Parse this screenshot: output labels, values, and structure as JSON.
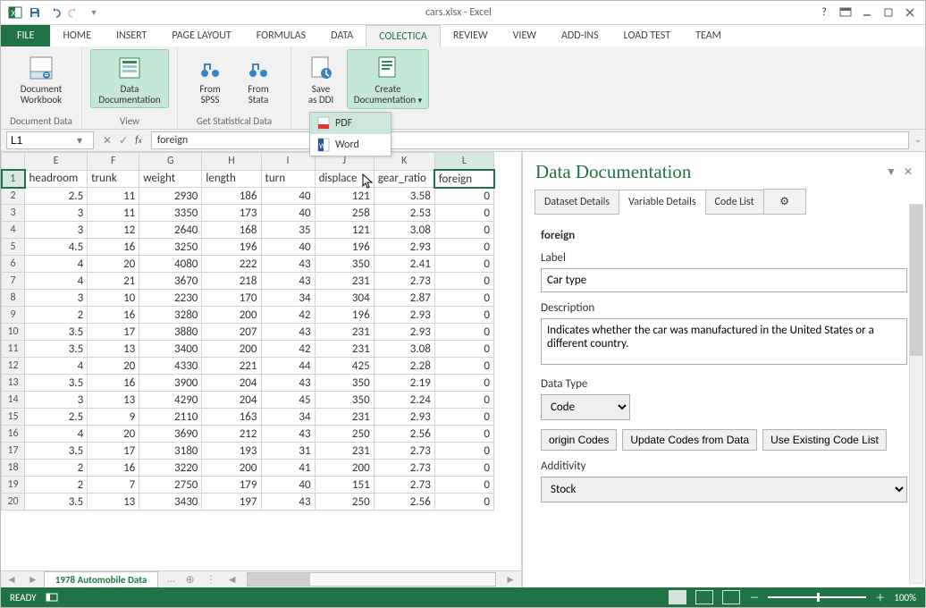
{
  "titlebar": {
    "title": "cars.xlsx - Excel"
  },
  "ribbon_tabs": [
    "FILE",
    "HOME",
    "INSERT",
    "PAGE LAYOUT",
    "FORMULAS",
    "DATA",
    "COLECTICA",
    "REVIEW",
    "VIEW",
    "ADD-INS",
    "LOAD TEST",
    "TEAM"
  ],
  "ribbon_active": "COLECTICA",
  "ribbon": {
    "document_workbook": "Document\nWorkbook",
    "data_documentation": "Data\nDocumentation",
    "from_spss": "From\nSPSS",
    "from_stata": "From\nStata",
    "save_ddi": "Save\nas DDI",
    "create_doc": "Create\nDocumentation",
    "groups": {
      "doc_data": "Document Data",
      "view": "View",
      "get_stat": "Get Statistical Data"
    }
  },
  "dropdown": {
    "pdf": "PDF",
    "word": "Word"
  },
  "formula": {
    "namebox": "L1",
    "value": "foreign"
  },
  "columns": [
    "E",
    "F",
    "G",
    "H",
    "I",
    "J",
    "K",
    "L"
  ],
  "headers": [
    "headroom",
    "trunk",
    "weight",
    "length",
    "turn",
    "displacement",
    "gear_ratio",
    "foreign"
  ],
  "rows": [
    {
      "n": 2,
      "v": [
        2.5,
        11,
        2930,
        186,
        40,
        121,
        3.58,
        0
      ]
    },
    {
      "n": 3,
      "v": [
        3,
        11,
        3350,
        173,
        40,
        258,
        2.53,
        0
      ]
    },
    {
      "n": 4,
      "v": [
        3,
        12,
        2640,
        168,
        35,
        121,
        3.08,
        0
      ]
    },
    {
      "n": 5,
      "v": [
        4.5,
        16,
        3250,
        196,
        40,
        196,
        2.93,
        0
      ]
    },
    {
      "n": 6,
      "v": [
        4,
        20,
        4080,
        222,
        43,
        350,
        2.41,
        0
      ]
    },
    {
      "n": 7,
      "v": [
        4,
        21,
        3670,
        218,
        43,
        231,
        2.73,
        0
      ]
    },
    {
      "n": 8,
      "v": [
        3,
        10,
        2230,
        170,
        34,
        304,
        2.87,
        0
      ]
    },
    {
      "n": 9,
      "v": [
        2,
        16,
        3280,
        200,
        42,
        196,
        2.93,
        0
      ]
    },
    {
      "n": 10,
      "v": [
        3.5,
        17,
        3880,
        207,
        43,
        231,
        2.93,
        0
      ]
    },
    {
      "n": 11,
      "v": [
        3.5,
        13,
        3400,
        200,
        42,
        231,
        3.08,
        0
      ]
    },
    {
      "n": 12,
      "v": [
        4,
        20,
        4330,
        221,
        44,
        425,
        2.28,
        0
      ]
    },
    {
      "n": 13,
      "v": [
        3.5,
        16,
        3900,
        204,
        43,
        350,
        2.19,
        0
      ]
    },
    {
      "n": 14,
      "v": [
        3,
        13,
        4290,
        204,
        45,
        350,
        2.24,
        0
      ]
    },
    {
      "n": 15,
      "v": [
        2.5,
        9,
        2110,
        163,
        34,
        231,
        2.93,
        0
      ]
    },
    {
      "n": 16,
      "v": [
        4,
        20,
        3690,
        212,
        43,
        250,
        2.56,
        0
      ]
    },
    {
      "n": 17,
      "v": [
        3.5,
        17,
        3180,
        193,
        31,
        231,
        2.73,
        0
      ]
    },
    {
      "n": 18,
      "v": [
        2,
        16,
        3220,
        200,
        41,
        200,
        2.73,
        0
      ]
    },
    {
      "n": 19,
      "v": [
        2,
        7,
        2750,
        179,
        40,
        151,
        2.73,
        0
      ]
    },
    {
      "n": 20,
      "v": [
        3.5,
        13,
        3430,
        197,
        43,
        250,
        2.56,
        0
      ]
    }
  ],
  "sheet_tab": "1978 Automobile Data",
  "pane": {
    "title": "Data Documentation",
    "tabs": [
      "Dataset Details",
      "Variable Details",
      "Code List"
    ],
    "active_tab": "Variable Details",
    "varname": "foreign",
    "label_field": "Label",
    "label_value": "Car type",
    "desc_field": "Description",
    "desc_value": "Indicates whether the car was manufactured in the United States or a different country.",
    "datatype_field": "Data Type",
    "datatype_value": "Code",
    "btn_origin": "origin Codes",
    "btn_update": "Update Codes from Data",
    "btn_existing": "Use Existing Code List",
    "additivity_field": "Additivity",
    "additivity_value": "Stock"
  },
  "status": {
    "ready": "READY",
    "zoom": "100%"
  }
}
